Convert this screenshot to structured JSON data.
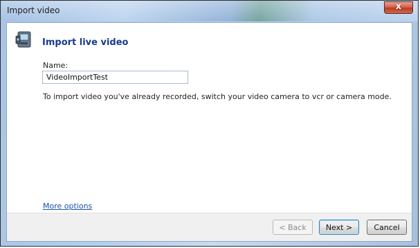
{
  "window": {
    "title": "Import video",
    "close_glyph": "x"
  },
  "header": {
    "icon": "video-camera-icon",
    "title": "Import live video"
  },
  "form": {
    "name_label": "Name:",
    "name_value": "VideoImportTest",
    "info_text": "To import video you've already recorded, switch your video camera to vcr or camera mode.",
    "more_options": "More options"
  },
  "buttons": {
    "back": "< Back",
    "next": "Next >",
    "cancel": "Cancel"
  },
  "colors": {
    "header_title": "#1a3a8c",
    "link": "#1c4fae",
    "close_button": "#c94a30"
  }
}
